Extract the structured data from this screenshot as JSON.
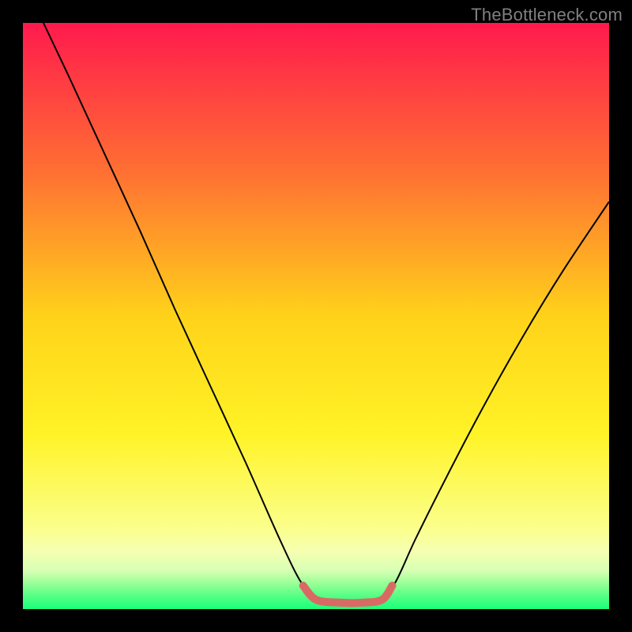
{
  "watermark": "TheBottleneck.com",
  "chart_data": {
    "type": "line",
    "title": "",
    "xlabel": "",
    "ylabel": "",
    "xlim": [
      0,
      1
    ],
    "ylim": [
      0,
      1
    ],
    "legend": false,
    "grid": false,
    "background": {
      "type": "vertical-gradient",
      "stops": [
        {
          "pos": 0.0,
          "color": "#ff1a4d"
        },
        {
          "pos": 0.25,
          "color": "#ff6e33"
        },
        {
          "pos": 0.5,
          "color": "#ffd21a"
        },
        {
          "pos": 0.7,
          "color": "#fff326"
        },
        {
          "pos": 0.86,
          "color": "#fbff8a"
        },
        {
          "pos": 0.9,
          "color": "#f6ffb0"
        },
        {
          "pos": 0.935,
          "color": "#d7ffb4"
        },
        {
          "pos": 0.95,
          "color": "#aaff9e"
        },
        {
          "pos": 0.965,
          "color": "#7dff8e"
        },
        {
          "pos": 0.98,
          "color": "#4dff84"
        },
        {
          "pos": 1.0,
          "color": "#1aff7a"
        }
      ]
    },
    "series": [
      {
        "name": "bottleneck-curve",
        "color": "#000000",
        "width": 2,
        "x": [
          0.035,
          0.08,
          0.14,
          0.2,
          0.26,
          0.32,
          0.38,
          0.44,
          0.475,
          0.5,
          0.53,
          0.57,
          0.61,
          0.635,
          0.67,
          0.72,
          0.78,
          0.85,
          0.92,
          1.0
        ],
        "y": [
          1.0,
          0.905,
          0.775,
          0.645,
          0.51,
          0.38,
          0.25,
          0.115,
          0.045,
          0.02,
          0.012,
          0.012,
          0.018,
          0.045,
          0.12,
          0.22,
          0.335,
          0.46,
          0.575,
          0.695
        ]
      },
      {
        "name": "sweet-spot-marker",
        "color": "#d96a63",
        "width": 10,
        "linecap": "round",
        "x": [
          0.478,
          0.5,
          0.54,
          0.58,
          0.613,
          0.63
        ],
        "y": [
          0.04,
          0.016,
          0.011,
          0.011,
          0.016,
          0.04
        ]
      }
    ]
  }
}
